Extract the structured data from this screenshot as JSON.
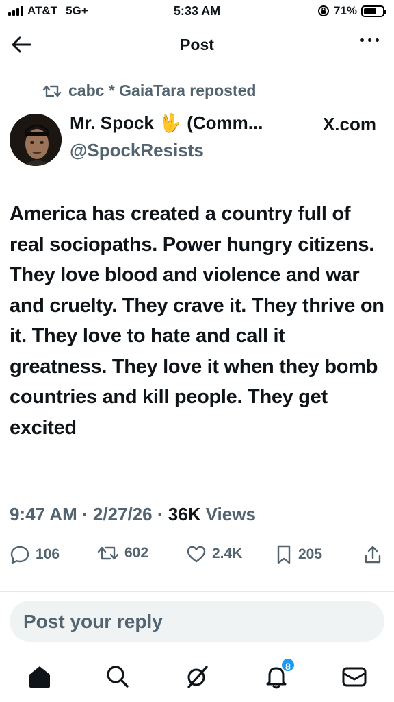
{
  "status_bar": {
    "carrier": "AT&T",
    "network": "5G+",
    "time": "5:33 AM",
    "battery_percent": "71%",
    "battery_level": 0.71
  },
  "header": {
    "title": "Post",
    "back_icon": "arrow-left-icon",
    "more_icon": "more-horizontal-icon"
  },
  "post": {
    "repost_label": "cabc * GaiaTara reposted",
    "author": {
      "name": "Mr. Spock",
      "name_emoji": "🖖",
      "name_suffix": "(Comm...",
      "handle": "@SpockResists",
      "source": "X.com"
    },
    "text": "America has created a country full of real sociopaths. Power hungry citizens. They love blood and violence and war and cruelty. They crave it. They thrive on it. They love to hate and call it greatness. They love it when they bomb countries and kill people. They get excited",
    "time": "9:47 AM",
    "date": "2/27/26",
    "views_count": "36K",
    "views_label": "Views",
    "stats": {
      "replies": "106",
      "reposts": "602",
      "likes": "2.4K",
      "bookmarks": "205"
    }
  },
  "reply": {
    "placeholder": "Post your reply"
  },
  "bottom_nav": {
    "notifications_badge": "8"
  },
  "colors": {
    "text_primary": "#0f1419",
    "text_secondary": "#536471",
    "accent": "#1d9bf0",
    "reply_bg": "#eff3f4"
  }
}
